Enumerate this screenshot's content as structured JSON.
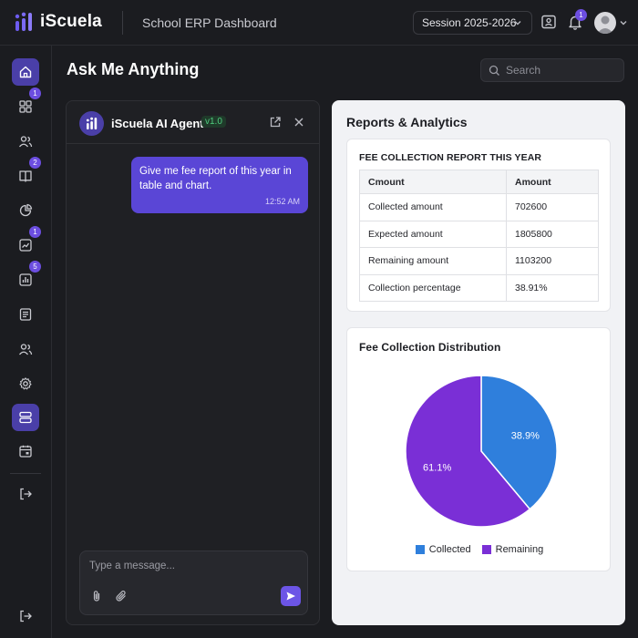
{
  "header": {
    "logo_text": "iScuela",
    "title": "School ERP Dashboard",
    "session_label": "Session 2025-2026",
    "notification_count": "1"
  },
  "sidebar": {
    "items": [
      {
        "name": "home",
        "badge": ""
      },
      {
        "name": "modules",
        "badge": "1"
      },
      {
        "name": "users",
        "badge": ""
      },
      {
        "name": "book",
        "badge": "2"
      },
      {
        "name": "pie",
        "badge": ""
      },
      {
        "name": "trend",
        "badge": "1"
      },
      {
        "name": "bar",
        "badge": "5"
      },
      {
        "name": "notes",
        "badge": ""
      },
      {
        "name": "people",
        "badge": ""
      },
      {
        "name": "settings",
        "badge": ""
      },
      {
        "name": "database",
        "badge": ""
      },
      {
        "name": "calendar",
        "badge": ""
      }
    ]
  },
  "page": {
    "title": "Ask Me Anything",
    "search_placeholder": "Search"
  },
  "chat": {
    "agent_name": "iScuela AI Agent",
    "agent_version": "v1.0",
    "messages": [
      {
        "text": "Give me fee report of this year in table and chart.",
        "time": "12:52 AM"
      }
    ],
    "composer_placeholder": "Type a message..."
  },
  "reports": {
    "title": "Reports & Analytics",
    "table_title": "FEE COLLECTION REPORT THIS YEAR",
    "columns": [
      "Cmount",
      "Amount"
    ],
    "rows": [
      [
        "Collected amount",
        "702600"
      ],
      [
        "Expected amount",
        "1805800"
      ],
      [
        "Remaining amount",
        "1103200"
      ],
      [
        "Collection percentage",
        "38.91%"
      ]
    ],
    "chart_title": "Fee Collection Distribution"
  },
  "colors": {
    "accent": "#5a46d6",
    "collected": "#2f7fdc",
    "remaining": "#7a2fd6"
  },
  "chart_data": {
    "type": "pie",
    "title": "Fee Collection Distribution",
    "labels": [
      "Collected",
      "Remaining"
    ],
    "values": [
      38.9,
      61.1
    ],
    "value_labels": [
      "38.9%",
      "61.1%"
    ],
    "colors": [
      "#2f7fdc",
      "#7a2fd6"
    ],
    "legend": "bottom"
  }
}
